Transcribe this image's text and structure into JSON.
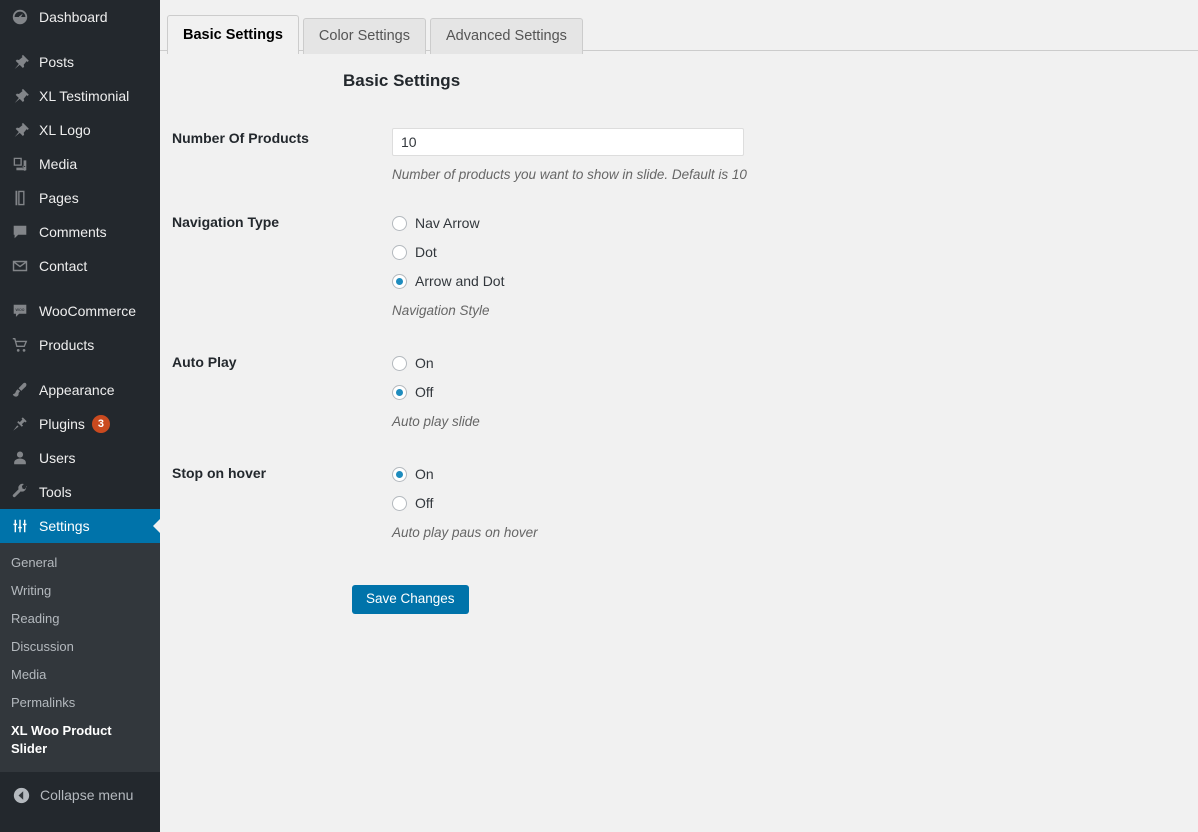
{
  "sidebar": {
    "items": [
      {
        "label": "Dashboard",
        "icon": "dashboard-icon",
        "gap": "none"
      },
      {
        "label": "Posts",
        "icon": "pin-icon",
        "gap": "large"
      },
      {
        "label": "XL Testimonial",
        "icon": "pin-icon",
        "gap": "none"
      },
      {
        "label": "XL Logo",
        "icon": "pin-icon",
        "gap": "none"
      },
      {
        "label": "Media",
        "icon": "media-icon",
        "gap": "none"
      },
      {
        "label": "Pages",
        "icon": "pages-icon",
        "gap": "none"
      },
      {
        "label": "Comments",
        "icon": "comments-icon",
        "gap": "none"
      },
      {
        "label": "Contact",
        "icon": "mail-icon",
        "gap": "none"
      },
      {
        "label": "WooCommerce",
        "icon": "woocommerce-icon",
        "gap": "large"
      },
      {
        "label": "Products",
        "icon": "cart-icon",
        "gap": "none"
      },
      {
        "label": "Appearance",
        "icon": "brush-icon",
        "gap": "large"
      },
      {
        "label": "Plugins",
        "icon": "plug-icon",
        "gap": "none",
        "badge": "3"
      },
      {
        "label": "Users",
        "icon": "user-icon",
        "gap": "none"
      },
      {
        "label": "Tools",
        "icon": "wrench-icon",
        "gap": "none"
      },
      {
        "label": "Settings",
        "icon": "settings-icon",
        "gap": "none",
        "current": true
      }
    ],
    "submenu": [
      {
        "label": "General"
      },
      {
        "label": "Writing"
      },
      {
        "label": "Reading"
      },
      {
        "label": "Discussion"
      },
      {
        "label": "Media"
      },
      {
        "label": "Permalinks"
      },
      {
        "label": "XL Woo Product Slider",
        "current": true
      }
    ],
    "collapse_label": "Collapse menu",
    "collapse_icon": "collapse-arrow-icon",
    "colors": {
      "background": "#23282d",
      "submenu_background": "#32373c",
      "current_background": "#0073aa",
      "badge": "#ca4a1f"
    }
  },
  "tabs": [
    {
      "label": "Basic Settings",
      "active": true
    },
    {
      "label": "Color Settings",
      "active": false
    },
    {
      "label": "Advanced Settings",
      "active": false
    }
  ],
  "main": {
    "heading": "Basic Settings",
    "save_label": "Save Changes",
    "accent_color": "#0073aa",
    "fields": [
      {
        "label": "Number Of Products",
        "type": "text",
        "value": "10",
        "placeholder": "",
        "description": "Number of products you want to show in slide. Default is 10"
      },
      {
        "label": "Navigation Type",
        "type": "radio",
        "description": "Navigation Style",
        "options": [
          {
            "label": "Nav Arrow",
            "checked": false
          },
          {
            "label": "Dot",
            "checked": false
          },
          {
            "label": "Arrow and Dot",
            "checked": true
          }
        ]
      },
      {
        "label": "Auto Play",
        "type": "radio",
        "description": "Auto play slide",
        "options": [
          {
            "label": "On",
            "checked": false
          },
          {
            "label": "Off",
            "checked": true
          }
        ]
      },
      {
        "label": "Stop on hover",
        "type": "radio",
        "description": "Auto play paus on hover",
        "options": [
          {
            "label": "On",
            "checked": true
          },
          {
            "label": "Off",
            "checked": false
          }
        ]
      }
    ]
  }
}
